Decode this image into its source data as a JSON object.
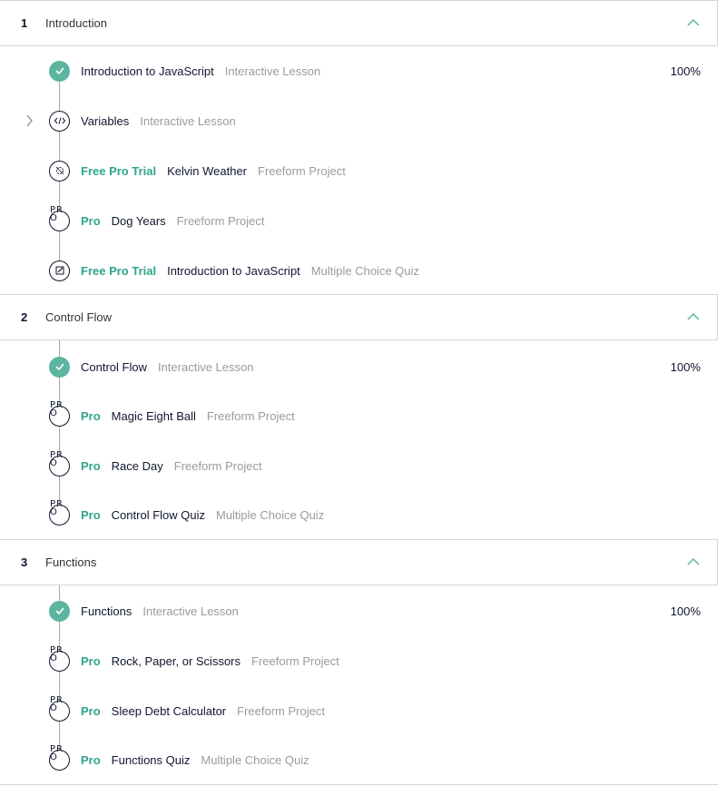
{
  "accent_color": "#5db4a0",
  "sections": [
    {
      "number": "1",
      "title": "Introduction",
      "items": [
        {
          "badge": "",
          "title": "Introduction to JavaScript",
          "kind": "Interactive Lesson",
          "progress": "100%",
          "state": "done",
          "icon": "check-icon"
        },
        {
          "badge": "",
          "title": "Variables",
          "kind": "Interactive Lesson",
          "progress": "",
          "state": "current",
          "icon": "code-icon"
        },
        {
          "badge": "Free Pro Trial",
          "title": "Kelvin Weather",
          "kind": "Freeform Project",
          "progress": "",
          "state": "project",
          "icon": "puzzle-icon"
        },
        {
          "badge": "Pro",
          "title": "Dog Years",
          "kind": "Freeform Project",
          "progress": "",
          "state": "pro",
          "icon": "pro-icon"
        },
        {
          "badge": "Free Pro Trial",
          "title": "Introduction to JavaScript",
          "kind": "Multiple Choice Quiz",
          "progress": "",
          "state": "quiz",
          "icon": "quiz-icon"
        }
      ]
    },
    {
      "number": "2",
      "title": "Control Flow",
      "items": [
        {
          "badge": "",
          "title": "Control Flow",
          "kind": "Interactive Lesson",
          "progress": "100%",
          "state": "done",
          "icon": "check-icon"
        },
        {
          "badge": "Pro",
          "title": "Magic Eight Ball",
          "kind": "Freeform Project",
          "progress": "",
          "state": "pro",
          "icon": "pro-icon"
        },
        {
          "badge": "Pro",
          "title": "Race Day",
          "kind": "Freeform Project",
          "progress": "",
          "state": "pro",
          "icon": "pro-icon"
        },
        {
          "badge": "Pro",
          "title": "Control Flow Quiz",
          "kind": "Multiple Choice Quiz",
          "progress": "",
          "state": "pro",
          "icon": "pro-icon"
        }
      ]
    },
    {
      "number": "3",
      "title": "Functions",
      "items": [
        {
          "badge": "",
          "title": "Functions",
          "kind": "Interactive Lesson",
          "progress": "100%",
          "state": "done",
          "icon": "check-icon"
        },
        {
          "badge": "Pro",
          "title": "Rock, Paper, or Scissors",
          "kind": "Freeform Project",
          "progress": "",
          "state": "pro",
          "icon": "pro-icon"
        },
        {
          "badge": "Pro",
          "title": "Sleep Debt Calculator",
          "kind": "Freeform Project",
          "progress": "",
          "state": "pro",
          "icon": "pro-icon"
        },
        {
          "badge": "Pro",
          "title": "Functions Quiz",
          "kind": "Multiple Choice Quiz",
          "progress": "",
          "state": "pro",
          "icon": "pro-icon"
        }
      ]
    }
  ],
  "pro_glyph": "PR O"
}
